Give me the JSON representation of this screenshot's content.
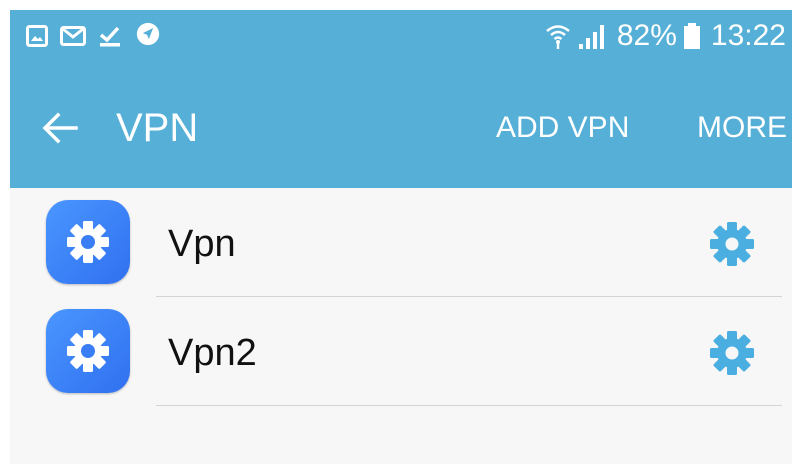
{
  "status_bar": {
    "battery_percent": "82%",
    "time": "13:22",
    "icons": [
      "image-notification-icon",
      "email-icon",
      "download-done-icon",
      "navigation-icon",
      "wifi-icon",
      "signal-icon",
      "battery-icon"
    ]
  },
  "toolbar": {
    "title": "VPN",
    "back_icon": "back-arrow-icon",
    "add_vpn_label": "ADD VPN",
    "more_label": "MORE"
  },
  "vpn_list": [
    {
      "label": "Vpn"
    },
    {
      "label": "Vpn2"
    }
  ],
  "colors": {
    "header": "#56afd6",
    "background": "#f7f7f7",
    "icon_blue": "#3a82f7",
    "gear_accent": "#4aaee0"
  }
}
